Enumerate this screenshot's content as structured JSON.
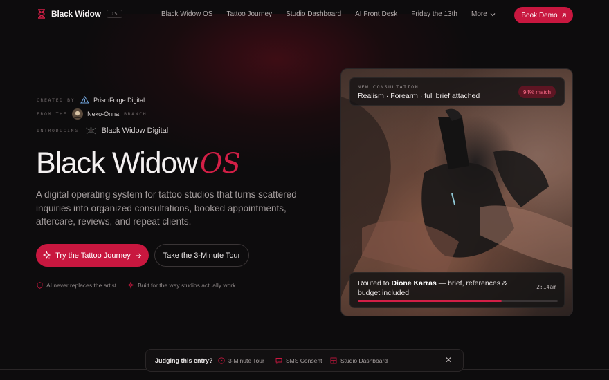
{
  "brand": {
    "name": "Black Widow",
    "badge": "OS",
    "icon": "hourglass-icon"
  },
  "nav": {
    "links": [
      "Black Widow OS",
      "Tattoo Journey",
      "Studio Dashboard",
      "AI Front Desk",
      "Friday the 13th",
      "More"
    ],
    "cta": "Book Demo"
  },
  "credits": {
    "created_by": {
      "label": "CREATED BY",
      "value": "PrismForge Digital",
      "icon": "triangle-logo-icon"
    },
    "from": {
      "label": "FROM THE",
      "value": "Neko-Onna",
      "suffix": "BRANCH",
      "icon": "avatar-icon"
    },
    "introducing": {
      "label": "INTRODUCING",
      "value": "Black Widow Digital",
      "icon": "spider-icon"
    }
  },
  "hero": {
    "title": "Black Widow",
    "title_accent": "OS",
    "subtitle": "A digital operating system for tattoo studios that turns scattered inquiries into organized consultations, booked appointments, aftercare, reviews, and repeat clients.",
    "primary_cta": "Try the Tattoo Journey",
    "secondary_cta": "Take the 3-Minute Tour",
    "notes": [
      "AI never replaces the artist",
      "Built for the way studios actually work"
    ]
  },
  "card": {
    "top": {
      "kicker": "NEW CONSULTATION",
      "title": "Realism · Forearm · full brief attached",
      "match": "94% match"
    },
    "bottom": {
      "prefix": "Routed to ",
      "artist": "Dione Karras",
      "suffix": " — brief, references & budget included",
      "time": "2:14am",
      "progress": 0.72
    }
  },
  "judging": {
    "label": "Judging this entry?",
    "items": [
      "3-Minute Tour",
      "SMS Consent",
      "Studio Dashboard"
    ],
    "close": "✕"
  },
  "colors": {
    "accent": "#c8173f",
    "accent_text": "#d21f46",
    "background": "#0d0c0d"
  }
}
